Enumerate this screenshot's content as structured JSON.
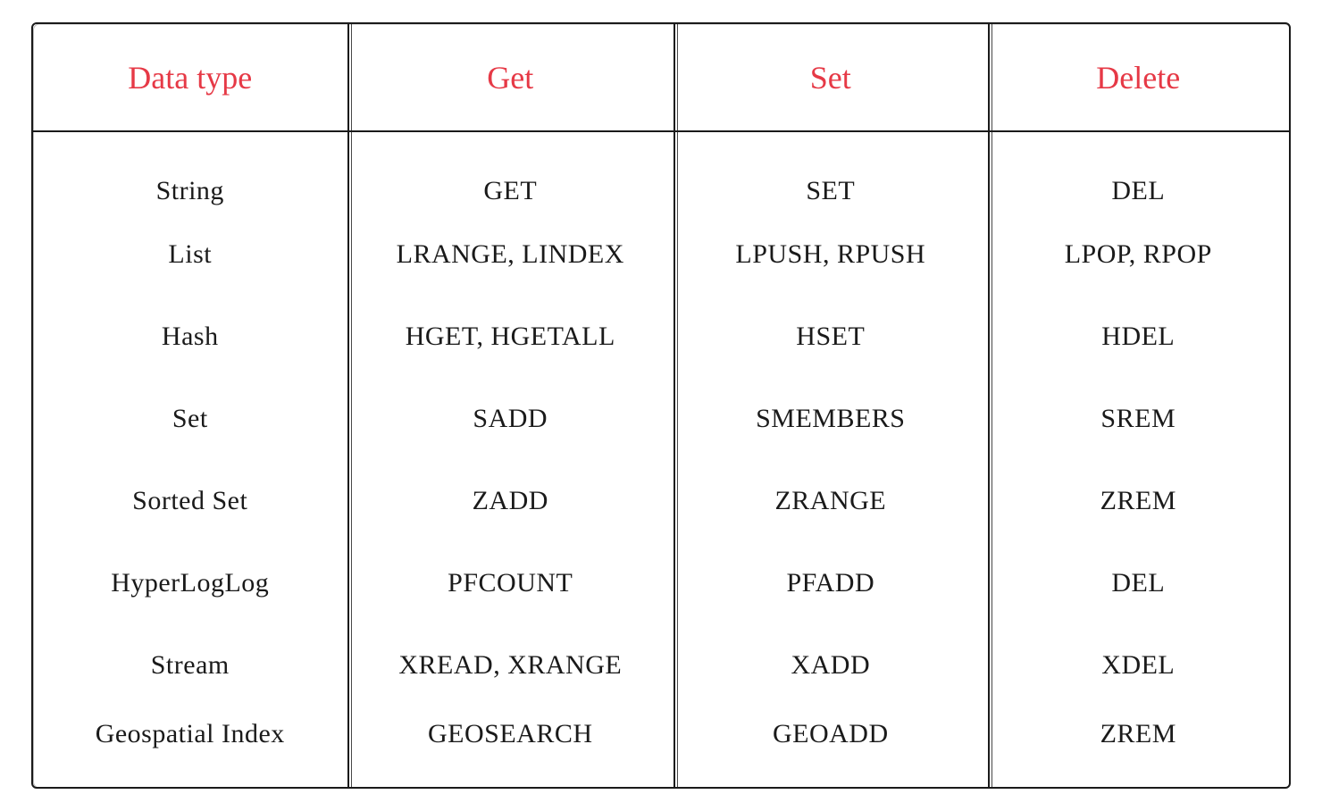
{
  "headers": {
    "dataType": "Data type",
    "get": "Get",
    "set": "Set",
    "delete": "Delete"
  },
  "rows": [
    {
      "dataType": "String",
      "get": "GET",
      "set": "SET",
      "delete": "DEL"
    },
    {
      "dataType": "List",
      "get": "LRANGE, LINDEX",
      "set": "LPUSH, RPUSH",
      "delete": "LPOP, RPOP"
    },
    {
      "dataType": "Hash",
      "get": "HGET, HGETALL",
      "set": "HSET",
      "delete": "HDEL"
    },
    {
      "dataType": "Set",
      "get": "SADD",
      "set": "SMEMBERS",
      "delete": "SREM"
    },
    {
      "dataType": "Sorted Set",
      "get": "ZADD",
      "set": "ZRANGE",
      "delete": "ZREM"
    },
    {
      "dataType": "HyperLogLog",
      "get": "PFCOUNT",
      "set": "PFADD",
      "delete": "DEL"
    },
    {
      "dataType": "Stream",
      "get": "XREAD, XRANGE",
      "set": "XADD",
      "delete": "XDEL"
    },
    {
      "dataType": "Geospatial Index",
      "get": "GEOSEARCH",
      "set": "GEOADD",
      "delete": "ZREM"
    }
  ]
}
